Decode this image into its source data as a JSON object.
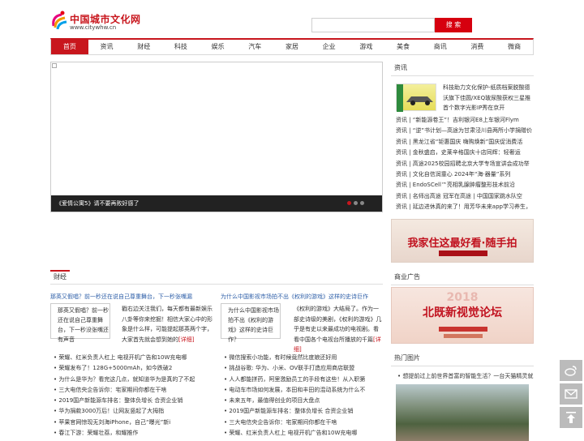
{
  "header": {
    "logo_title": "中国城市文化网",
    "logo_url": "www.citywhw.cn",
    "search_placeholder": "",
    "search_button": "搜 索"
  },
  "nav": [
    "首页",
    "资讯",
    "财经",
    "科技",
    "娱乐",
    "汽车",
    "家居",
    "企业",
    "游戏",
    "美食",
    "商讯",
    "消费",
    "微商"
  ],
  "slider": {
    "caption": "《爱情公寓5》请不要再败好感了"
  },
  "right_news": {
    "title": "资讯",
    "top_text": "科技助力文化保护-纸质档案脱酸德沃旗下佳圆/XEQ玻尿酸获权三星推首个数字光影IP秀在京开",
    "items": [
      "资讯 | “新能源卷王”！吉利银河E8上车银河Flym",
      "资讯 | “逆”书计划—高途为甘肃泾川县两所小学捐赠价",
      "资讯 | 黑龙江省“钜惠国庆 嗨购焕新”国庆促消费活",
      "资讯 | 金秋盛启，史莱辛格国庆十店同辉：轻奢运",
      "资讯 | 高途2025校园招聘北京大学专场宣讲会成功举",
      "资讯 | 文化自信润童心 2024年“海·器量”系列",
      "资讯 | EndoSCell™亮相乳腺肿瘤整形技术前沿",
      "资讯 | 名师出高途 冠军在高途 | 中国国家跳水队空",
      "资讯 | 延边进休真的来了！用芳华未来app学习养生，"
    ]
  },
  "banner1": {
    "text": "我家住这最好看·随手拍"
  },
  "ad": {
    "title": "商业广告",
    "year": "2018",
    "text": "北既新视觉论坛"
  },
  "hot": {
    "title": "热门图片",
    "caption": "想提前过上前世界首富的智能生活？一台天猫精灵就"
  },
  "finance": {
    "title": "财经",
    "left": {
      "headline": "那英又假唱？前一秒还在说自己尊重舞台，下一秒张嘴漏",
      "img_alt": "那英又假唱？前一秒还在说自己尊重舞台，下一秒没张嘴还有声音",
      "desc": "戳右边关注我们，每天都有最新娱乐八卦等你来挖掘！相信大家心中的形象是什么样，可能提起那英两个字，大家首先就会想到她的",
      "more": "[详细]",
      "items": [
        "荣耀、红米负责人杠上 电视开机广告和10W充电哪",
        "荣耀发布了！128G+5000mAh，如今跌破2",
        "为什么是华为？看完这几点，就知道华为是真的了不起",
        "三大电信央企告诉你：宅家期间你都在干啥",
        "2019国产新能源车排名：整体负增长 合资企业销",
        "华为捐款3000万后！让网友竖起了大拇指",
        "苹果官网惊现无刘海iPhone，自己“曝光”新i",
        "春江下游：荣耀壮荔，和耀推作"
      ]
    },
    "right": {
      "headline": "为什么中国影视市场拍不出《权利的游戏》这样的史诗巨作",
      "img_alt": "为什么中国影视市场拍不出《权利的游戏》这样的史诗巨作？",
      "desc": "《权利的游戏》大结局了。作为一部史诗级的美剧，《权利的游戏》几乎是有史以来最成功的电视剧。看看中国各个电视台所播放的千篇",
      "more": "[详细]",
      "items": [
        "微信搜索小功能，有时候竟然比度娘还好用",
        "挑战谷歌: 华为、小米、OV联手打造应用商店联盟",
        "人人都能拼药，阿里激励员工的手段有这些！从入职第",
        "电动车市场如何发展，本田和丰田的混动系统为什么不",
        "未来五年，最值得创业的项目大盘点",
        "2019国产新能源车排名：整体负增长 合资企业销",
        "三大电信央企告诉你：宅家期间你都在干啥",
        "荣耀、红米负责人杠上 电视开机广告和10W充电哪"
      ]
    }
  },
  "side_buttons": [
    "weibo-icon",
    "mail-icon",
    "back-to-top-icon"
  ]
}
